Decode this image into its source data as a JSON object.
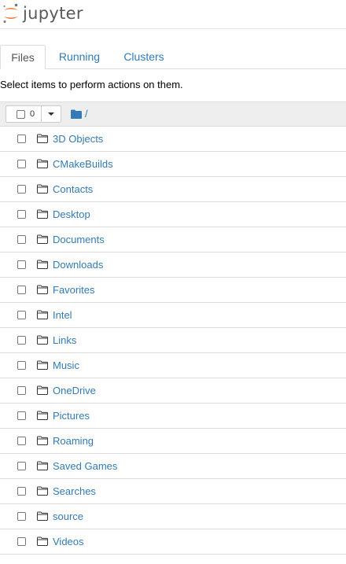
{
  "app": {
    "logo_text": "jupyter"
  },
  "tabs": [
    {
      "label": "Files",
      "active": true
    },
    {
      "label": "Running",
      "active": false
    },
    {
      "label": "Clusters",
      "active": false
    }
  ],
  "instructions": "Select items to perform actions on them.",
  "toolbar": {
    "selected_count": "0",
    "breadcrumb_separator": "/"
  },
  "items": [
    {
      "name": "3D Objects",
      "icon": "folder-icon"
    },
    {
      "name": "CMakeBuilds",
      "icon": "folder-icon"
    },
    {
      "name": "Contacts",
      "icon": "folder-icon"
    },
    {
      "name": "Desktop",
      "icon": "folder-icon"
    },
    {
      "name": "Documents",
      "icon": "folder-icon"
    },
    {
      "name": "Downloads",
      "icon": "folder-icon"
    },
    {
      "name": "Favorites",
      "icon": "folder-icon"
    },
    {
      "name": "Intel",
      "icon": "folder-icon"
    },
    {
      "name": "Links",
      "icon": "folder-icon"
    },
    {
      "name": "Music",
      "icon": "folder-icon"
    },
    {
      "name": "OneDrive",
      "icon": "folder-icon"
    },
    {
      "name": "Pictures",
      "icon": "folder-icon"
    },
    {
      "name": "Roaming",
      "icon": "folder-icon"
    },
    {
      "name": "Saved Games",
      "icon": "folder-icon"
    },
    {
      "name": "Searches",
      "icon": "folder-icon"
    },
    {
      "name": "source",
      "icon": "folder-icon"
    },
    {
      "name": "Videos",
      "icon": "folder-icon"
    }
  ],
  "colors": {
    "link": "#337ab7",
    "logo_orange": "#f37726",
    "logo_gray": "#767677",
    "header_bg": "#eeeeee",
    "row_border": "#dddddd"
  }
}
